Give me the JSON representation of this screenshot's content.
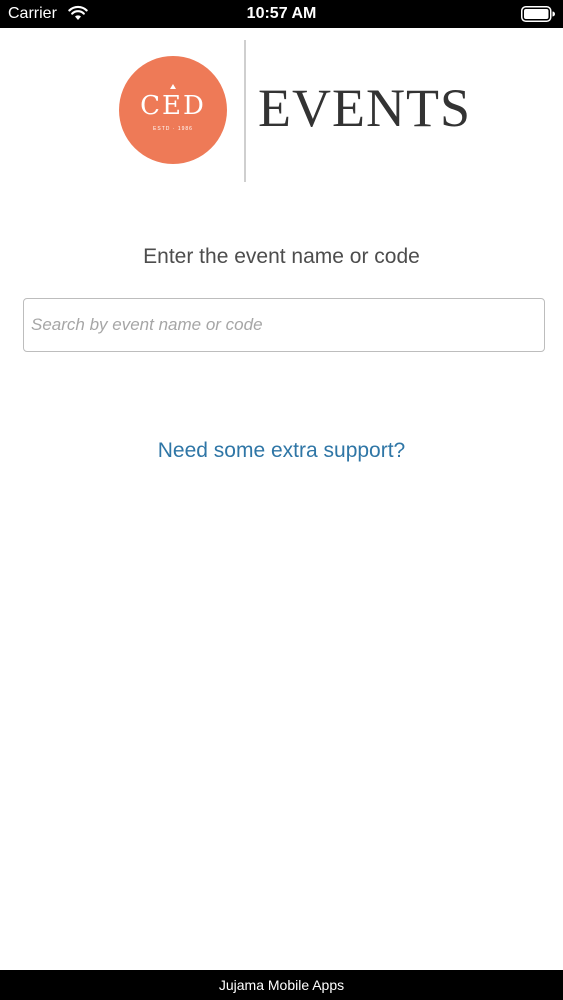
{
  "status_bar": {
    "carrier": "Carrier",
    "time": "10:57 AM",
    "wifi_icon": "wifi-icon",
    "battery_icon": "battery-icon"
  },
  "logo": {
    "circle_color": "#ee7a57",
    "letters": "CED",
    "subtext": "ESTD · 1986",
    "wordmark": "EVENTS"
  },
  "search": {
    "prompt": "Enter the event name or code",
    "placeholder": "Search by event name or code",
    "value": ""
  },
  "support": {
    "link_text": "Need some extra support?",
    "link_color": "#2f76a6"
  },
  "footer": {
    "text": "Jujama Mobile Apps"
  }
}
